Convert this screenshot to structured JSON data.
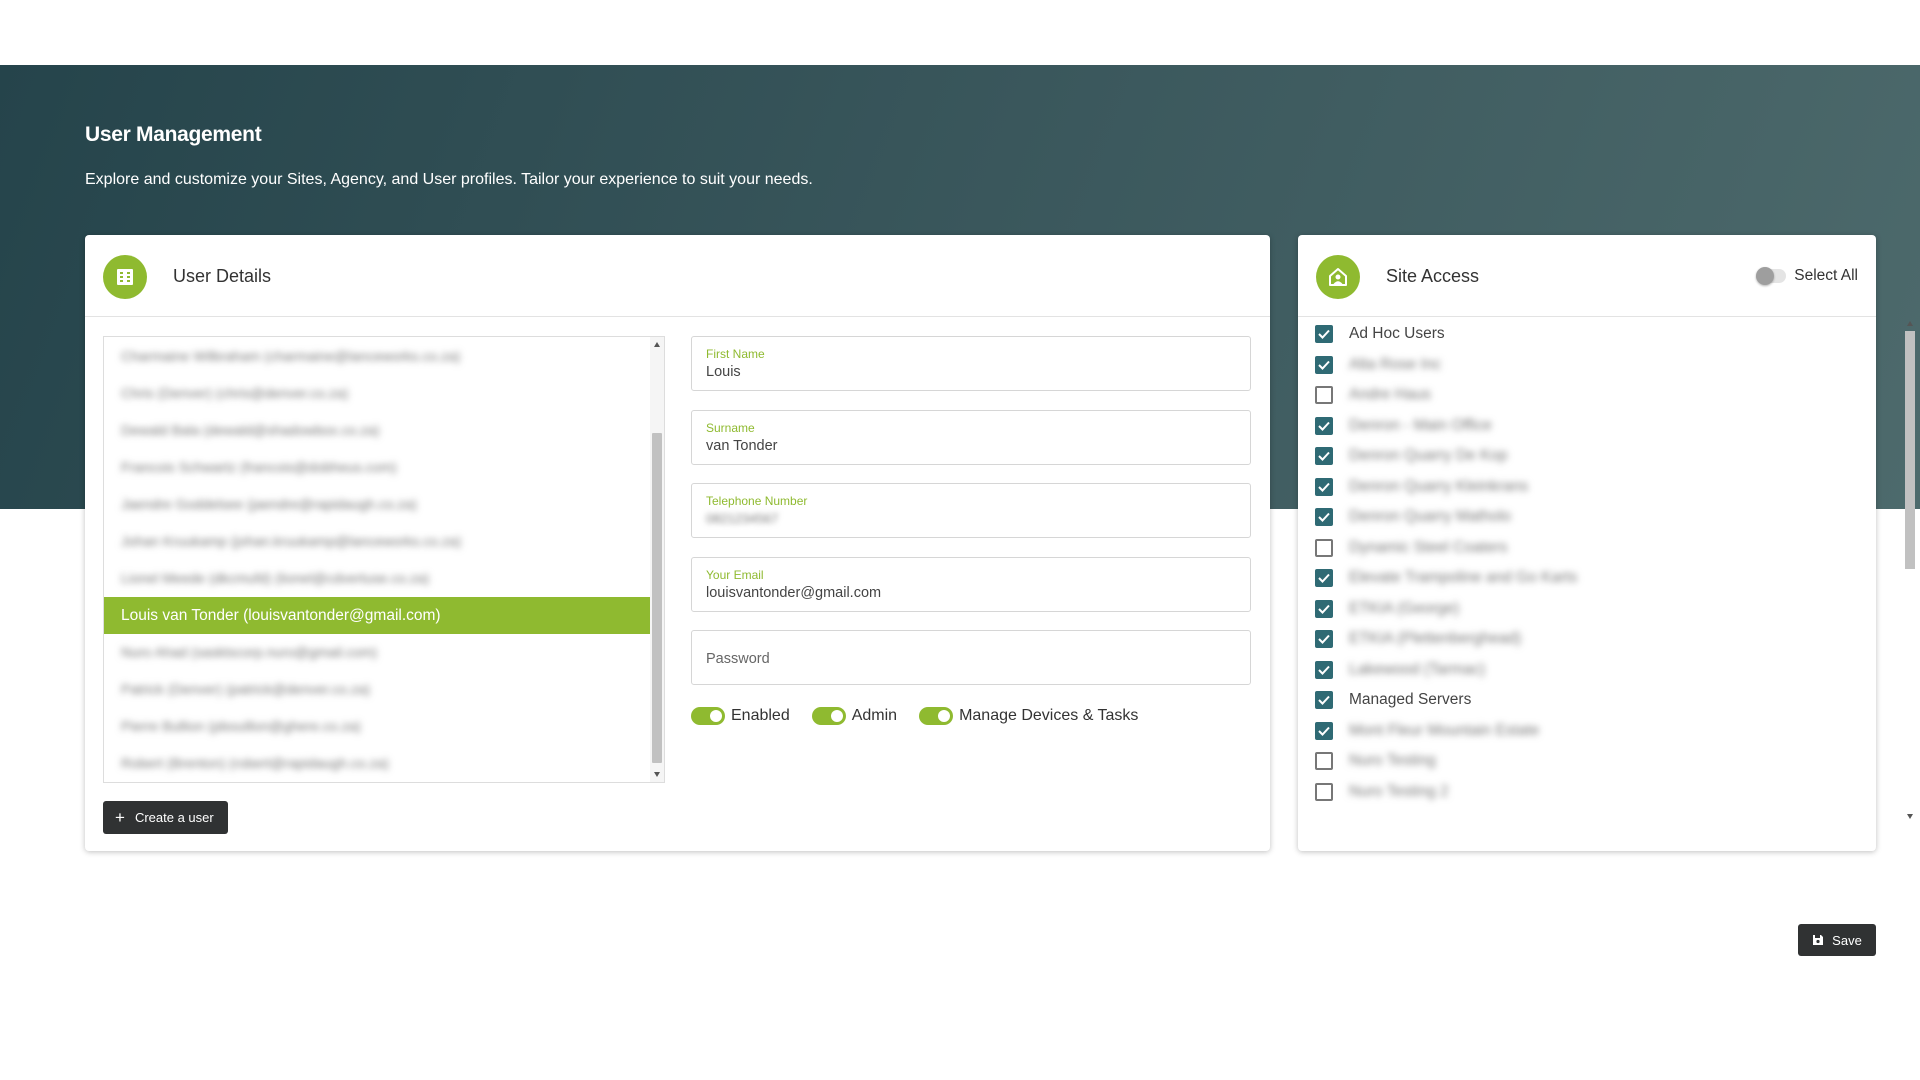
{
  "header": {
    "title": "User Management",
    "subtitle": "Explore and customize your Sites, Agency, and User profiles. Tailor your experience to suit your needs."
  },
  "user_details": {
    "title": "User Details",
    "icon": "building-icon",
    "users": [
      {
        "label": "Charmaine Wilbraham (charmaine@lanceworks.co.za)",
        "selected": false
      },
      {
        "label": "Chris (Denver) (chris@denver.co.za)",
        "selected": false
      },
      {
        "label": "Dewald Bala (dewald@shadowbox.co.za)",
        "selected": false
      },
      {
        "label": "Francois Schwartz (francois@dobheus.com)",
        "selected": false
      },
      {
        "label": "Jaendre Goddelsee (jaendre@rapidaugh.co.za)",
        "selected": false
      },
      {
        "label": "Johan Kruukamp (johan.kruukamp@lanceworks.co.za)",
        "selected": false
      },
      {
        "label": "Lionel Meede (dkcmufd) (lionel@cdvertuse.co.za)",
        "selected": false
      },
      {
        "label": "Louis van Tonder (louisvantonder@gmail.com)",
        "selected": true
      },
      {
        "label": "Nuro Ahad (sasktscorp.nuro@gmail.com)",
        "selected": false
      },
      {
        "label": "Patrick (Denver) (patrick@denver.co.za)",
        "selected": false
      },
      {
        "label": "Pierre Bullion (pbouillon@ghere.co.za)",
        "selected": false
      },
      {
        "label": "Robert (Brenton) (robert@rapidaugh.co.za)",
        "selected": false
      }
    ],
    "fields": {
      "first_name": {
        "label": "First Name",
        "value": "Louis"
      },
      "surname": {
        "label": "Surname",
        "value": "van Tonder"
      },
      "telephone": {
        "label": "Telephone Number",
        "value": "0821234567"
      },
      "email": {
        "label": "Your Email",
        "value": "louisvantonder@gmail.com"
      },
      "password": {
        "placeholder": "Password"
      }
    },
    "toggles": [
      {
        "label": "Enabled",
        "on": true
      },
      {
        "label": "Admin",
        "on": true
      },
      {
        "label": "Manage Devices & Tasks",
        "on": true
      }
    ],
    "create_button": "Create a user"
  },
  "site_access": {
    "title": "Site Access",
    "icon": "home-user-icon",
    "select_all_label": "Select All",
    "select_all_on": false,
    "sites": [
      {
        "label": "Ad Hoc Users",
        "checked": true,
        "obscured": false
      },
      {
        "label": "Alta Rose Inc",
        "checked": true,
        "obscured": true
      },
      {
        "label": "Andre Haus",
        "checked": false,
        "obscured": true
      },
      {
        "label": "Denron - Main Office",
        "checked": true,
        "obscured": true
      },
      {
        "label": "Denron Quarry De Kop",
        "checked": true,
        "obscured": true
      },
      {
        "label": "Denron Quarry Kleinkrans",
        "checked": true,
        "obscured": true
      },
      {
        "label": "Denron Quarry Matholo",
        "checked": true,
        "obscured": true
      },
      {
        "label": "Dynamic Steel Coaters",
        "checked": false,
        "obscured": true
      },
      {
        "label": "Elevate Trampoline and Go Karts",
        "checked": true,
        "obscured": true
      },
      {
        "label": "ETKIA (George)",
        "checked": true,
        "obscured": true
      },
      {
        "label": "ETKIA (Plettenberghead)",
        "checked": true,
        "obscured": true
      },
      {
        "label": "Lakewood (Tarmac)",
        "checked": true,
        "obscured": true
      },
      {
        "label": "Managed Servers",
        "checked": true,
        "obscured": false
      },
      {
        "label": "Mont Fleur Mountain Estate",
        "checked": true,
        "obscured": true
      },
      {
        "label": "Nuro Testing",
        "checked": false,
        "obscured": true
      },
      {
        "label": "Nuro Testing 2",
        "checked": false,
        "obscured": true
      }
    ]
  },
  "save_button": "Save",
  "colors": {
    "accent": "#8fba30",
    "checkbox": "#2f6a74",
    "button": "#303233",
    "hero_start": "#25444b",
    "hero_end": "#4d6a6c"
  }
}
